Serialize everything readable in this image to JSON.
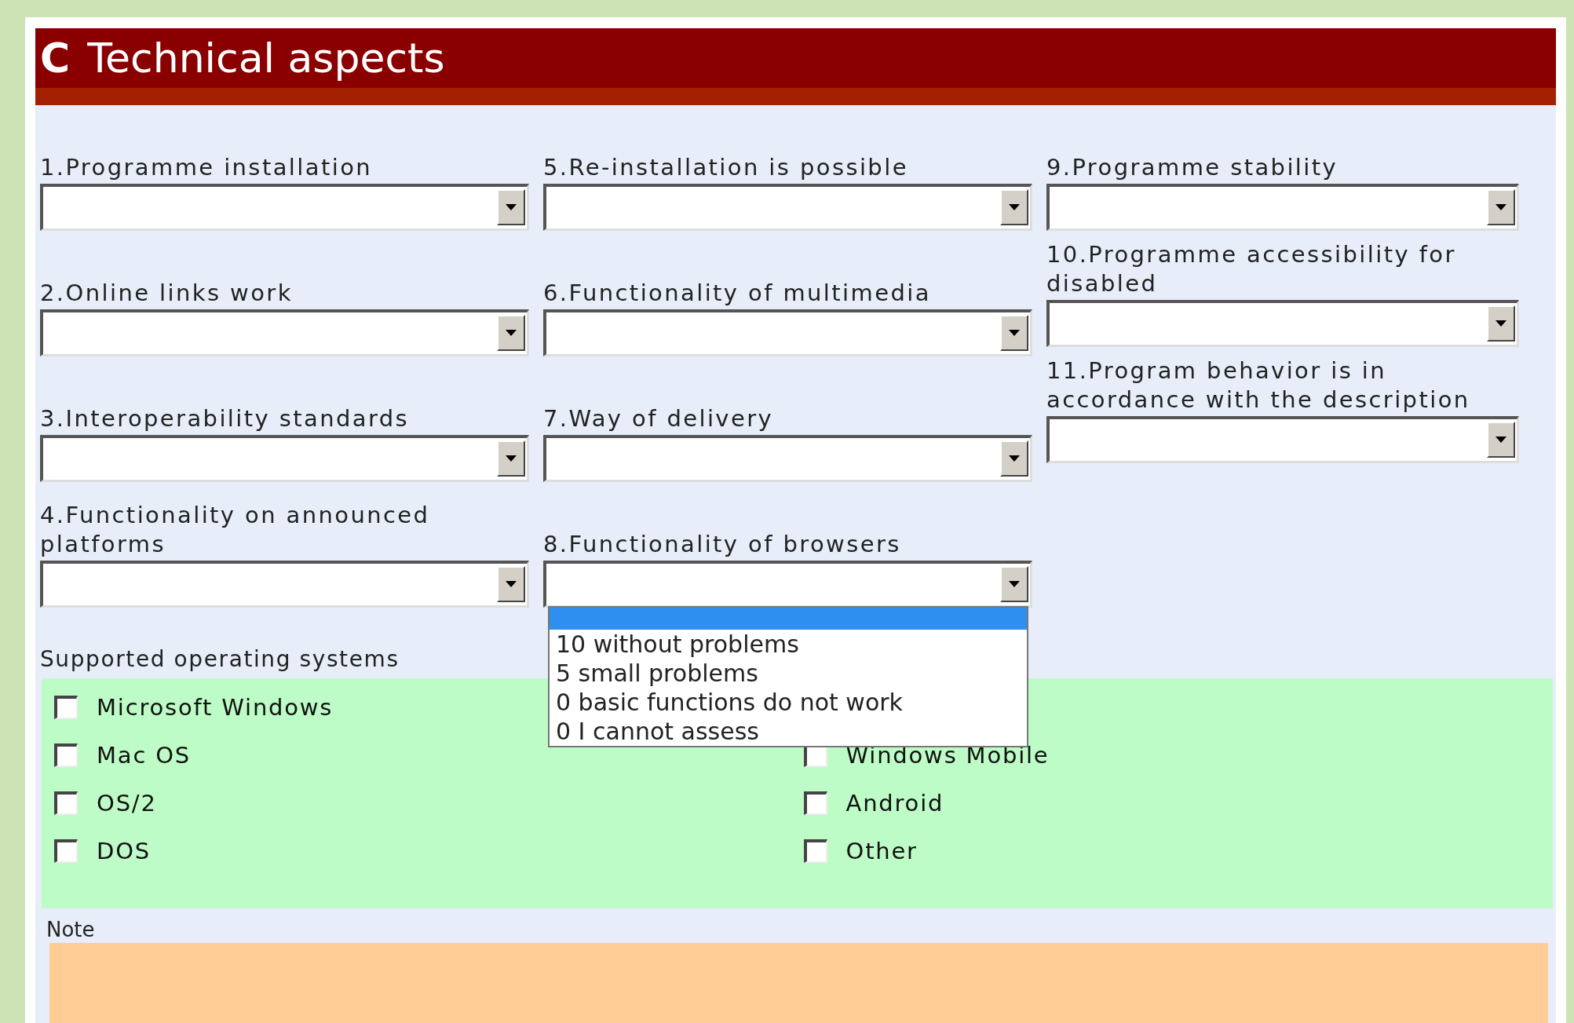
{
  "header": {
    "letter": "C",
    "title": "Technical aspects"
  },
  "columns": [
    {
      "fields": [
        {
          "label": "1.Programme installation",
          "expanded": false
        },
        {
          "label": "2.Online links work",
          "expanded": false
        },
        {
          "label": "3.Interoperability standards",
          "expanded": false
        },
        {
          "label": "4.Functionality on announced platforms",
          "expanded": false
        }
      ]
    },
    {
      "fields": [
        {
          "label": "5.Re-installation is possible",
          "expanded": false
        },
        {
          "label": "6.Functionality of multimedia",
          "expanded": false
        },
        {
          "label": "7.Way of delivery",
          "expanded": false
        },
        {
          "label": "8.Functionality of browsers",
          "expanded": true,
          "blank_option_highlighted": true,
          "options": [
            "10 without problems",
            "5 small problems",
            "0 basic functions do not work",
            "0 I cannot assess"
          ]
        }
      ]
    },
    {
      "fields": [
        {
          "label": "9.Programme stability",
          "expanded": false
        },
        {
          "label": "10.Programme accessibility for disabled",
          "expanded": false
        },
        {
          "label": "11.Program behavior is in accordance with the description",
          "expanded": false
        }
      ]
    }
  ],
  "operating_systems": {
    "label": "Supported operating systems",
    "left": [
      {
        "label": "Microsoft Windows",
        "checked": false
      },
      {
        "label": "Mac OS",
        "checked": false
      },
      {
        "label": "OS/2",
        "checked": false
      },
      {
        "label": "DOS",
        "checked": false
      }
    ],
    "right": [
      {
        "label": "Windows Mobile",
        "checked": false
      },
      {
        "label": "Android",
        "checked": false
      },
      {
        "label": "Other",
        "checked": false
      }
    ]
  },
  "note": {
    "label": "Note"
  }
}
